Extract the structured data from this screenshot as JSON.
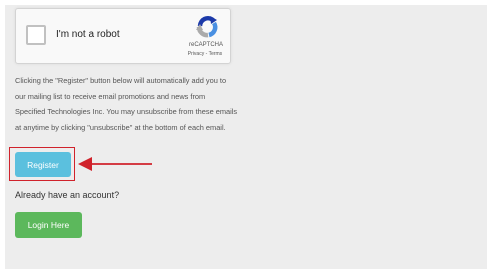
{
  "recaptcha": {
    "label": "I'm not a robot",
    "brand": "reCAPTCHA",
    "privacy": "Privacy",
    "separator": " - ",
    "terms": "Terms"
  },
  "notice": {
    "lines": [
      "Clicking the \"Register\" button below will automatically add you to",
      "our mailing list to receive email promotions and news from",
      "Specified Technologies Inc. You may unsubscribe from these emails",
      "at anytime by clicking \"unsubscribe\" at the bottom of each email."
    ]
  },
  "register_button": {
    "label": "Register"
  },
  "already_account": "Already have an account?",
  "login_button": {
    "label": "Login Here"
  },
  "colors": {
    "register": "#5bc0de",
    "login": "#5cb85c",
    "annotation": "#d0222b"
  },
  "icons": {
    "recaptcha_logo": "recaptcha-logo",
    "annotation_arrow": "arrow-left-icon"
  }
}
